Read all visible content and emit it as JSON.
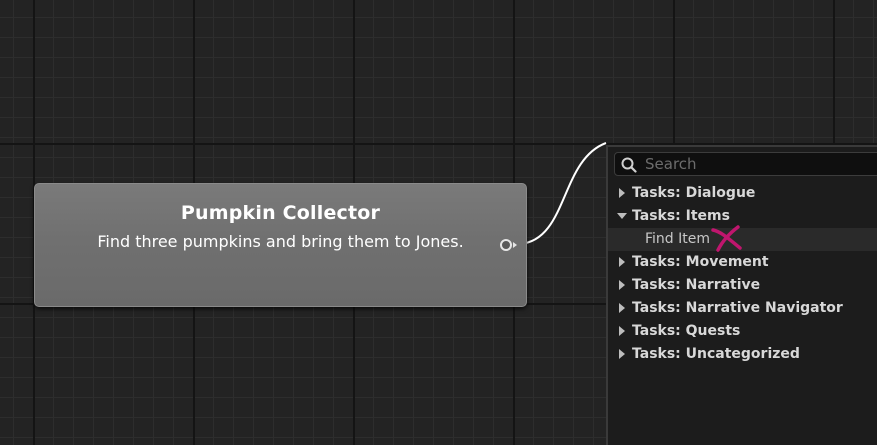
{
  "node": {
    "title": "Pumpkin Collector",
    "description": "Find three pumpkins and bring them to Jones."
  },
  "search": {
    "placeholder": "Search",
    "value": ""
  },
  "tree": {
    "items": [
      {
        "label": "Tasks: Dialogue",
        "expanded": false
      },
      {
        "label": "Tasks: Items",
        "expanded": true,
        "children": [
          {
            "label": "Find Item"
          }
        ]
      },
      {
        "label": "Tasks: Movement",
        "expanded": false
      },
      {
        "label": "Tasks: Narrative",
        "expanded": false
      },
      {
        "label": "Tasks: Narrative Navigator",
        "expanded": false
      },
      {
        "label": "Tasks: Quests",
        "expanded": false
      },
      {
        "label": "Tasks: Uncategorized",
        "expanded": false
      }
    ]
  },
  "icons": {
    "search": "magnifier-icon",
    "expand": "triangle-right-icon",
    "collapse": "triangle-down-icon",
    "mark": "x-annotation-icon"
  },
  "colors": {
    "background": "#232323",
    "node": "#707070",
    "wire": "#ffffff",
    "annotation": "#c0166e"
  }
}
